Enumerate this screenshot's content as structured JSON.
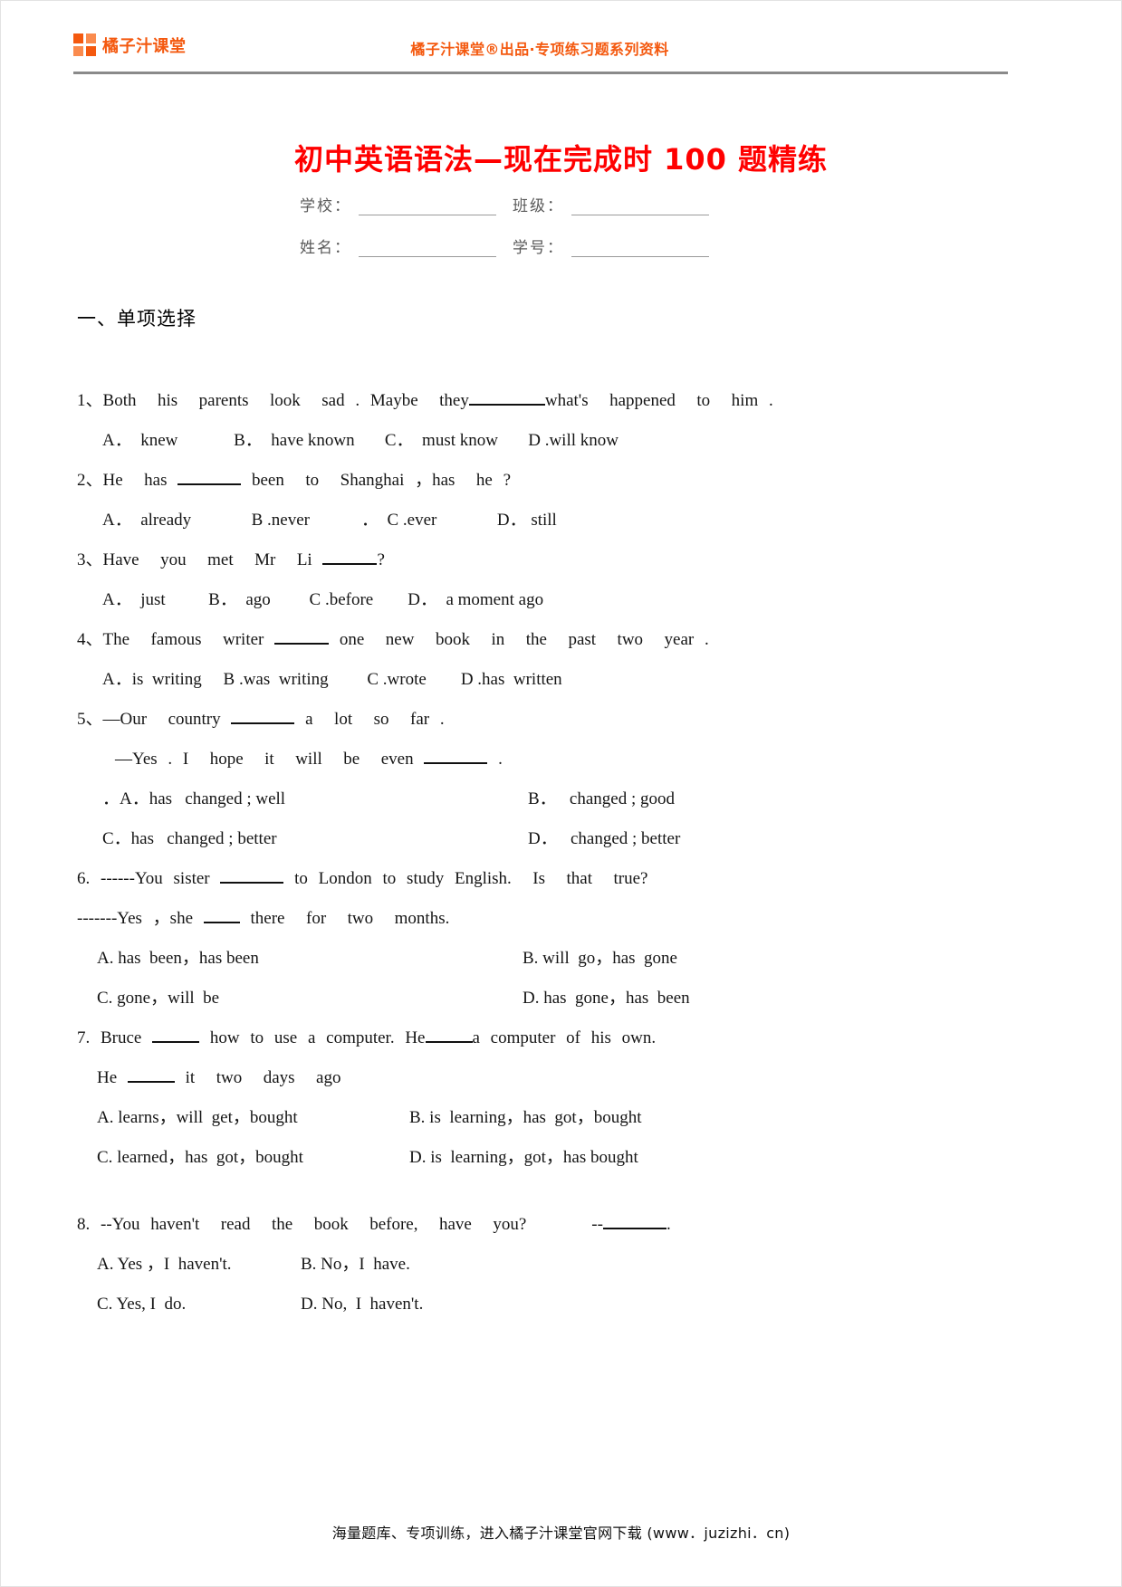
{
  "header": {
    "logo_text": "橘子汁课堂",
    "center_text": "橘子汁课堂®出品·专项练习题系列资料"
  },
  "title": "初中英语语法—现在完成时 100 题精练",
  "meta": {
    "school_label": "学校：",
    "class_label": "班级：",
    "name_label": "姓名：",
    "id_label": "学号："
  },
  "section": {
    "heading": "一、单项选择"
  },
  "questions": [
    {
      "number": "1、",
      "stem": "Both  his  parents  look  sad . Maybe  they",
      "stem_tail": "what's  happened  to  him .",
      "options_line": "A．  knew             B．  have known       C．  must know       D .will know"
    },
    {
      "number": "2、",
      "stem": "He  has",
      "stem_tail": "been  to  Shanghai ，has  he ?",
      "options_line": "A．  already              B .never            ．  C .ever              D． still"
    },
    {
      "number": "3、",
      "stem": "Have  you  met  Mr  Li",
      "stem_tail": "?",
      "options_line": "A．  just          B．  ago         C .before        D．  a moment ago"
    },
    {
      "number": "4、",
      "stem": "The  famous  writer",
      "stem_tail": "one  new  book  in  the  past  two  year .",
      "options_line": "A．is  writing     B .was  writing         C .wrote        D .has  written"
    },
    {
      "number": "5、",
      "stem": "—Our  country",
      "stem_tail": "a  lot  so  far .",
      "continuation_pre": "—Yes . I  hope  it  will  be  even",
      "continuation_post": ".",
      "options_grid": [
        "．A．has   changed ; well",
        "B．   changed ; good",
        "C．has   changed ; better",
        "D．   changed ; better"
      ]
    },
    {
      "number": "6.",
      "stem": "------You sister",
      "stem_tail": "to London to study English.  Is  that  true?",
      "continuation_pre": "-------Yes ，she",
      "continuation_post": "there  for  two  months.",
      "options_grid": [
        "A. has  been，has been",
        "B. will  go，has  gone",
        "C. gone，will  be",
        "D. has  gone，has  been"
      ]
    },
    {
      "number": "7.",
      "stem": "Bruce",
      "stem_mid": "how to use a computer. He",
      "stem_tail": "a computer of his own.",
      "continuation_pre": "He",
      "continuation_post": "it  two  days  ago",
      "options_grid": [
        "A. learns，will  get，bought",
        "B. is  learning，has  got，bought",
        "C. learned，has  got，bought",
        "D. is  learning，got，has bought"
      ]
    },
    {
      "number": "8.",
      "stem": "--You haven't  read  the  book  before,  have  you?",
      "stem_tail": "--",
      "stem_end": ".",
      "options_grid": [
        "A. Yes ，I  haven't.",
        "B. No，I  have.",
        "C. Yes, I  do.",
        "D. No,  I  haven't."
      ]
    }
  ],
  "footer": {
    "text": "海量题库、专项训练，进入橘子汁课堂官网下载 (www．juzizhi．cn)"
  },
  "colors": {
    "brand_orange": "#f4590f",
    "title_red": "#ff0000",
    "rule_gray": "#8a8a8a"
  }
}
